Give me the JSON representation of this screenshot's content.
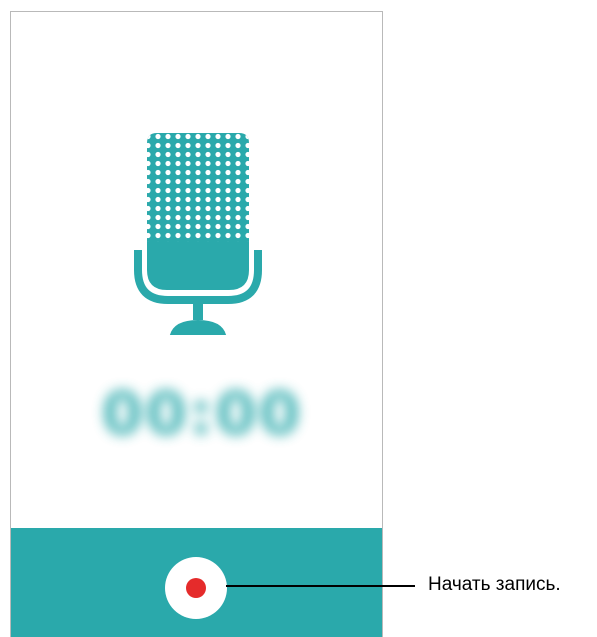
{
  "timer": {
    "text": "00:00"
  },
  "record_button": {
    "icon": "record-dot-icon",
    "dot_color": "#e52b2b"
  },
  "callout": {
    "text": "Начать запись."
  },
  "colors": {
    "accent": "#2aa9ab",
    "record": "#e52b2b"
  },
  "icons": {
    "microphone": "microphone-icon"
  }
}
